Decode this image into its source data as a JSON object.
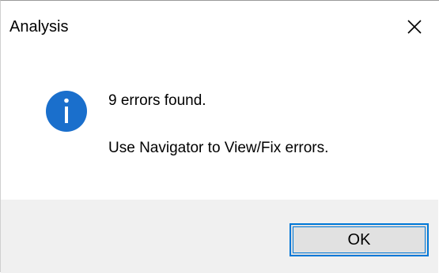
{
  "window": {
    "title": "Analysis",
    "close_icon": "close-icon"
  },
  "message": {
    "icon": "info-icon",
    "icon_color": "#1a6fcc",
    "line1": "9 errors found.",
    "line2": "Use Navigator to View/Fix errors."
  },
  "buttons": {
    "ok_label": "OK",
    "accent": "#0078d7"
  }
}
